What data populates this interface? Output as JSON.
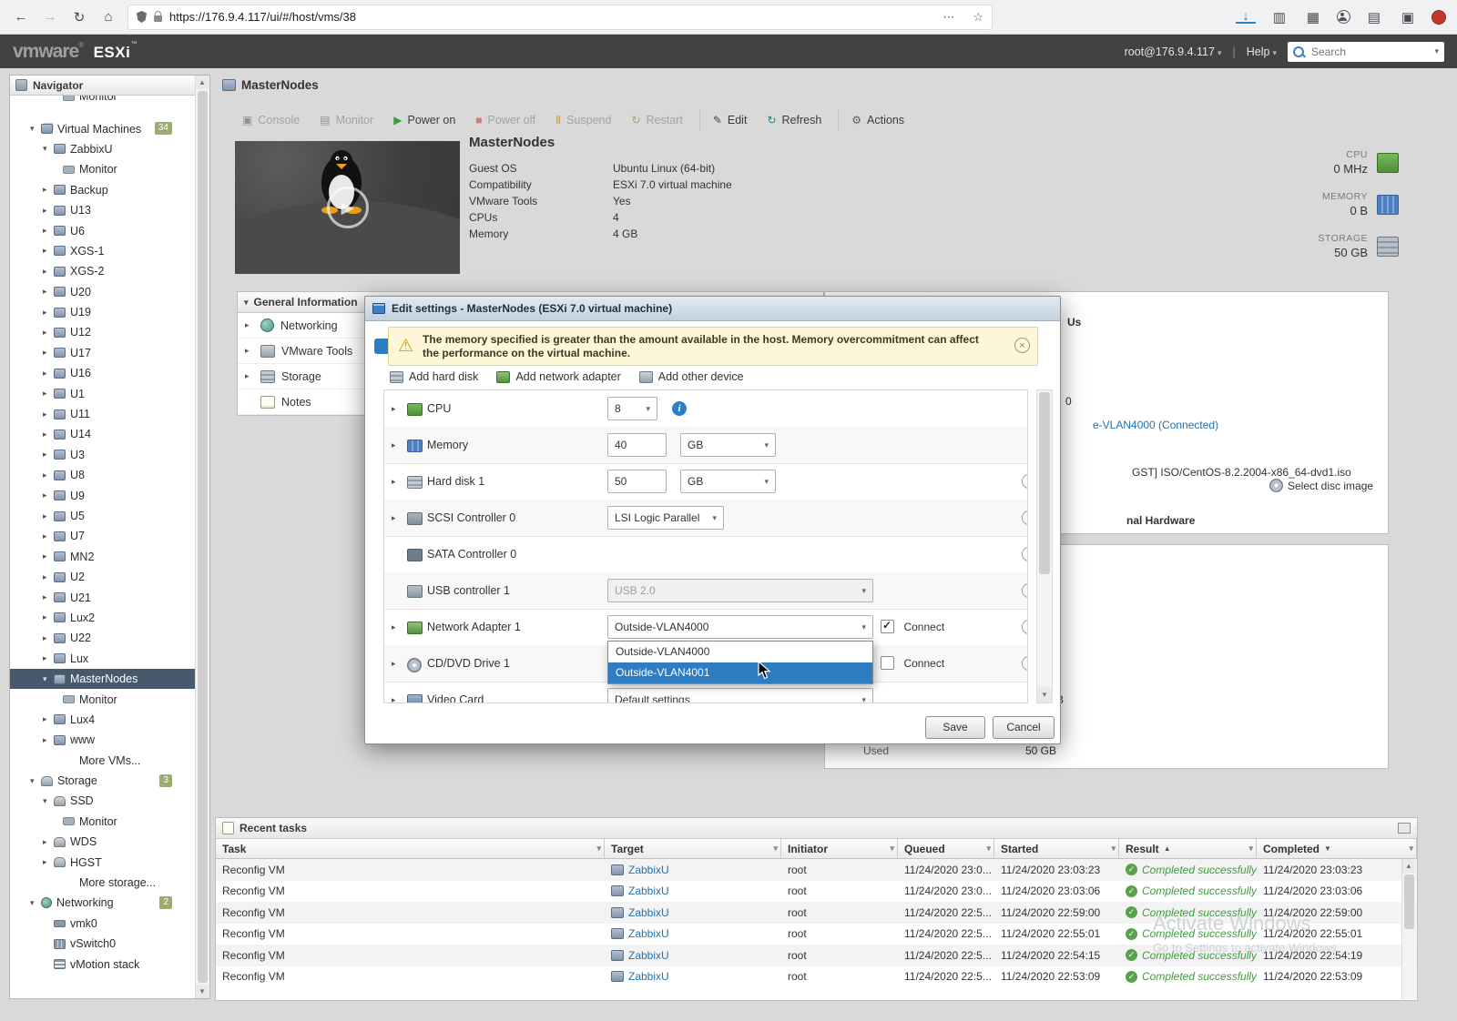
{
  "browser": {
    "url": "https://176.9.4.117/ui/#/host/vms/38"
  },
  "topbar": {
    "brand_vmware": "vmware",
    "brand_esxi": "ESXi",
    "user": "root@176.9.4.117",
    "sep": "|",
    "help": "Help",
    "search_placeholder": "Search"
  },
  "navigator": {
    "title": "Navigator",
    "cut_item": {
      "label": "Monitor"
    },
    "items": [
      {
        "label": "Virtual Machines",
        "level": 0,
        "arrow": "expanded",
        "icon": "vms",
        "badge": "34"
      },
      {
        "label": "ZabbixU",
        "level": 1,
        "arrow": "expanded",
        "icon": "vm"
      },
      {
        "label": "Monitor",
        "level": 2,
        "icon": "monitor"
      },
      {
        "label": "Backup",
        "level": 1,
        "arrow": "collapsed",
        "icon": "vm"
      },
      {
        "label": "U13",
        "level": 1,
        "arrow": "collapsed",
        "icon": "vm"
      },
      {
        "label": "U6",
        "level": 1,
        "arrow": "collapsed",
        "icon": "vm"
      },
      {
        "label": "XGS-1",
        "level": 1,
        "arrow": "collapsed",
        "icon": "vm"
      },
      {
        "label": "XGS-2",
        "level": 1,
        "arrow": "collapsed",
        "icon": "vm"
      },
      {
        "label": "U20",
        "level": 1,
        "arrow": "collapsed",
        "icon": "vm"
      },
      {
        "label": "U19",
        "level": 1,
        "arrow": "collapsed",
        "icon": "vm"
      },
      {
        "label": "U12",
        "level": 1,
        "arrow": "collapsed",
        "icon": "vm"
      },
      {
        "label": "U17",
        "level": 1,
        "arrow": "collapsed",
        "icon": "vm"
      },
      {
        "label": "U16",
        "level": 1,
        "arrow": "collapsed",
        "icon": "vm"
      },
      {
        "label": "U1",
        "level": 1,
        "arrow": "collapsed",
        "icon": "vm"
      },
      {
        "label": "U11",
        "level": 1,
        "arrow": "collapsed",
        "icon": "vm"
      },
      {
        "label": "U14",
        "level": 1,
        "arrow": "collapsed",
        "icon": "vm"
      },
      {
        "label": "U3",
        "level": 1,
        "arrow": "collapsed",
        "icon": "vm"
      },
      {
        "label": "U8",
        "level": 1,
        "arrow": "collapsed",
        "icon": "vm"
      },
      {
        "label": "U9",
        "level": 1,
        "arrow": "collapsed",
        "icon": "vm"
      },
      {
        "label": "U5",
        "level": 1,
        "arrow": "collapsed",
        "icon": "vm"
      },
      {
        "label": "U7",
        "level": 1,
        "arrow": "collapsed",
        "icon": "vm"
      },
      {
        "label": "MN2",
        "level": 1,
        "arrow": "collapsed",
        "icon": "vm"
      },
      {
        "label": "U2",
        "level": 1,
        "arrow": "collapsed",
        "icon": "vm"
      },
      {
        "label": "U21",
        "level": 1,
        "arrow": "collapsed",
        "icon": "vm"
      },
      {
        "label": "Lux2",
        "level": 1,
        "arrow": "collapsed",
        "icon": "vm"
      },
      {
        "label": "U22",
        "level": 1,
        "arrow": "collapsed",
        "icon": "vm"
      },
      {
        "label": "Lux",
        "level": 1,
        "arrow": "collapsed",
        "icon": "vm"
      },
      {
        "label": "MasterNodes",
        "level": 1,
        "arrow": "expanded",
        "icon": "vm",
        "selected": true
      },
      {
        "label": "Monitor",
        "level": 2,
        "icon": "monitor"
      },
      {
        "label": "Lux4",
        "level": 1,
        "arrow": "collapsed",
        "icon": "vm"
      },
      {
        "label": "www",
        "level": 1,
        "arrow": "collapsed",
        "icon": "vm"
      },
      {
        "label": "More VMs...",
        "level": 2
      },
      {
        "label": "Storage",
        "level": 0,
        "arrow": "expanded",
        "icon": "storage",
        "badge": "3"
      },
      {
        "label": "SSD",
        "level": 1,
        "arrow": "expanded",
        "icon": "datastore"
      },
      {
        "label": "Monitor",
        "level": 2,
        "icon": "monitor"
      },
      {
        "label": "WDS",
        "level": 1,
        "arrow": "collapsed",
        "icon": "datastore"
      },
      {
        "label": "HGST",
        "level": 1,
        "arrow": "collapsed",
        "icon": "datastore"
      },
      {
        "label": "More storage...",
        "level": 2
      },
      {
        "label": "Networking",
        "level": 0,
        "arrow": "expanded",
        "icon": "network",
        "badge": "2"
      },
      {
        "label": "vmk0",
        "level": 1,
        "icon": "nic"
      },
      {
        "label": "vSwitch0",
        "level": 1,
        "icon": "switch"
      },
      {
        "label": "vMotion stack",
        "level": 1,
        "icon": "stack"
      }
    ]
  },
  "page": {
    "title": "MasterNodes"
  },
  "toolbar": {
    "buttons": [
      {
        "label": "Console",
        "icon": "console",
        "state": "disabled"
      },
      {
        "label": "Monitor",
        "icon": "monitor",
        "state": "disabled"
      },
      {
        "label": "Power on",
        "icon": "power-on",
        "state": "enabled"
      },
      {
        "label": "Power off",
        "icon": "power-off",
        "state": "disabled"
      },
      {
        "label": "Suspend",
        "icon": "suspend",
        "state": "disabled"
      },
      {
        "label": "Restart",
        "icon": "restart",
        "state": "disabled"
      },
      {
        "label": "Edit",
        "icon": "edit",
        "state": "enabled",
        "divider": true
      },
      {
        "label": "Refresh",
        "icon": "refresh",
        "state": "enabled"
      },
      {
        "label": "Actions",
        "icon": "actions",
        "state": "enabled",
        "divider": true
      }
    ]
  },
  "vm": {
    "name": "MasterNodes",
    "fields": [
      {
        "label": "Guest OS",
        "value": "Ubuntu Linux (64-bit)"
      },
      {
        "label": "Compatibility",
        "value": "ESXi 7.0 virtual machine"
      },
      {
        "label": "VMware Tools",
        "value": "Yes"
      },
      {
        "label": "CPUs",
        "value": "4"
      },
      {
        "label": "Memory",
        "value": "4 GB"
      }
    ],
    "stats": [
      {
        "label": "CPU",
        "value": "0 MHz",
        "icon": "cpu"
      },
      {
        "label": "MEMORY",
        "value": "0 B",
        "icon": "memory"
      },
      {
        "label": "STORAGE",
        "value": "50 GB",
        "icon": "storage"
      }
    ]
  },
  "general_info": {
    "title": "General Information",
    "rows": [
      {
        "label": "Networking",
        "icon": "networking",
        "arrow": true
      },
      {
        "label": "VMware Tools",
        "icon": "vmware-tools",
        "arrow": true
      },
      {
        "label": "Storage",
        "icon": "storage",
        "arrow": true
      },
      {
        "label": "Notes",
        "icon": "notes"
      }
    ]
  },
  "background_fragments": [
    {
      "text": "Us"
    },
    {
      "text": "0"
    },
    {
      "text": "e-VLAN4000 (Connected)"
    },
    {
      "text": "GST] ISO/CentOS-8.2.2004-x86_64-dvd1.iso"
    },
    {
      "text": "Select disc image"
    },
    {
      "text": "nal Hardware"
    },
    {
      "text": "B"
    },
    {
      "text": "Used"
    },
    {
      "text": "50 GB"
    }
  ],
  "modal": {
    "title": "Edit settings - MasterNodes (ESXi 7.0 virtual machine)",
    "warning": {
      "line1": "The memory specified is greater than the amount available in the host. Memory overcommitment can affect",
      "line2": "the performance on the virtual machine."
    },
    "add_buttons": [
      {
        "label": "Add hard disk",
        "icon": "hard-disk"
      },
      {
        "label": "Add network adapter",
        "icon": "network-adapter"
      },
      {
        "label": "Add other device",
        "icon": "other-device"
      }
    ],
    "rows": {
      "cpu": {
        "label": "CPU",
        "value": "8"
      },
      "memory": {
        "label": "Memory",
        "value": "40",
        "unit": "GB"
      },
      "hard_disk": {
        "label": "Hard disk 1",
        "value": "50",
        "unit": "GB"
      },
      "scsi": {
        "label": "SCSI Controller 0",
        "value": "LSI Logic Parallel"
      },
      "sata": {
        "label": "SATA Controller 0"
      },
      "usb": {
        "label": "USB controller 1",
        "value": "USB 2.0"
      },
      "network": {
        "label": "Network Adapter 1",
        "value": "Outside-VLAN4000",
        "connect": "Connect",
        "connected": true
      },
      "cd": {
        "label": "CD/DVD Drive 1",
        "connect": "Connect",
        "connected": false
      },
      "video": {
        "label": "Video Card",
        "value": "Default settings"
      }
    },
    "dropdown": {
      "options": [
        "Outside-VLAN4000",
        "Outside-VLAN4001"
      ],
      "highlighted_index": 1
    },
    "buttons": {
      "save": "Save",
      "cancel": "Cancel"
    }
  },
  "tasks": {
    "title": "Recent tasks",
    "columns": [
      {
        "label": "Task"
      },
      {
        "label": "Target"
      },
      {
        "label": "Initiator"
      },
      {
        "label": "Queued"
      },
      {
        "label": "Started"
      },
      {
        "label": "Result",
        "sort": "asc"
      },
      {
        "label": "Completed",
        "sort": "desc"
      }
    ],
    "rows": [
      {
        "task": "Reconfig VM",
        "target": "ZabbixU",
        "initiator": "root",
        "queued": "11/24/2020 23:0...",
        "started": "11/24/2020 23:03:23",
        "result": "Completed successfully",
        "completed": "11/24/2020 23:03:23"
      },
      {
        "task": "Reconfig VM",
        "target": "ZabbixU",
        "initiator": "root",
        "queued": "11/24/2020 23:0...",
        "started": "11/24/2020 23:03:06",
        "result": "Completed successfully",
        "completed": "11/24/2020 23:03:06"
      },
      {
        "task": "Reconfig VM",
        "target": "ZabbixU",
        "initiator": "root",
        "queued": "11/24/2020 22:5...",
        "started": "11/24/2020 22:59:00",
        "result": "Completed successfully",
        "completed": "11/24/2020 22:59:00"
      },
      {
        "task": "Reconfig VM",
        "target": "ZabbixU",
        "initiator": "root",
        "queued": "11/24/2020 22:5...",
        "started": "11/24/2020 22:55:01",
        "result": "Completed successfully",
        "completed": "11/24/2020 22:55:01"
      },
      {
        "task": "Reconfig VM",
        "target": "ZabbixU",
        "initiator": "root",
        "queued": "11/24/2020 22:5...",
        "started": "11/24/2020 22:54:15",
        "result": "Completed successfully",
        "completed": "11/24/2020 22:54:19"
      },
      {
        "task": "Reconfig VM",
        "target": "ZabbixU",
        "initiator": "root",
        "queued": "11/24/2020 22:5...",
        "started": "11/24/2020 22:53:09",
        "result": "Completed successfully",
        "completed": "11/24/2020 22:53:09"
      }
    ]
  },
  "watermark": {
    "line1": "Activate Windows",
    "line2": "Go to Settings to activate Windows."
  }
}
